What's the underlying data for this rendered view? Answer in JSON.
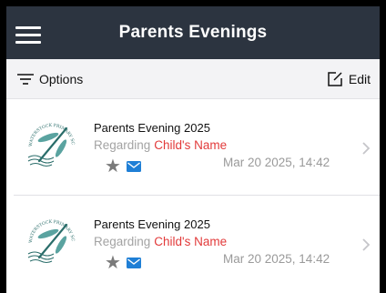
{
  "header": {
    "title": "Parents Evenings"
  },
  "toolbar": {
    "options_label": "Options",
    "edit_label": "Edit"
  },
  "school_logo_text": "WATERSTOCK PRIMARY SCHOOL",
  "evenings": [
    {
      "title": "Parents Evening 2025",
      "regarding_label": "Regarding",
      "child_name": "Child's Name",
      "date": "Mar 20 2025, 14:42"
    },
    {
      "title": "Parents Evening 2025",
      "regarding_label": "Regarding",
      "child_name": "Child's Name",
      "date": "Mar 20 2025, 14:42"
    }
  ],
  "colors": {
    "navbar": "#2c3440",
    "child_name": "#e23a3a",
    "mail_icon": "#1f7fd6",
    "logo": "#2a6d6a"
  },
  "icons": {
    "menu": "hamburger-menu-icon",
    "options": "filter-lines-icon",
    "edit": "edit-square-icon",
    "favourite": "star-icon",
    "message": "envelope-icon",
    "disclosure": "chevron-right-icon"
  }
}
